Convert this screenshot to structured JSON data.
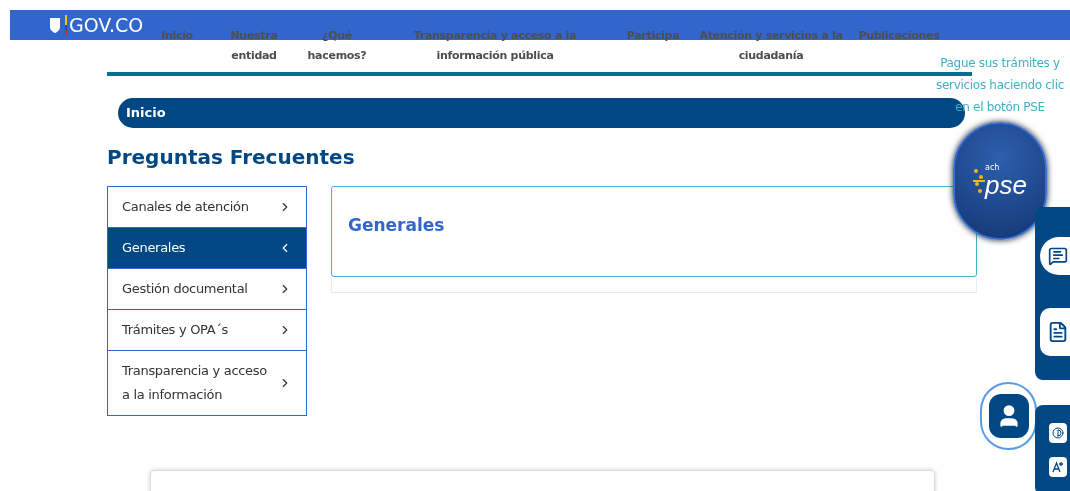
{
  "gov_bar": {
    "logo": "GOV.CO"
  },
  "nav": [
    {
      "label": "Inicio"
    },
    {
      "label": "Nuestra entidad"
    },
    {
      "label": "¿Qué hacemos?"
    },
    {
      "label": "Transparencia y acceso a la información pública"
    },
    {
      "label": "Participa"
    },
    {
      "label": "Atención y servicios a la ciudadanía"
    },
    {
      "label": "Publicaciones"
    }
  ],
  "breadcrumb": "Inicio",
  "page_title": "Preguntas Frecuentes",
  "sidebar": {
    "items": [
      {
        "label": "Canales de atención",
        "selected": false
      },
      {
        "label": "Generales",
        "selected": true
      },
      {
        "label": "Gestión documental",
        "selected": false
      },
      {
        "label": "Trámites y OPA´s",
        "selected": false
      },
      {
        "label": "Transparencia y acceso a la información",
        "selected": false
      }
    ]
  },
  "content": {
    "heading": "Generales"
  },
  "pse": {
    "message": "Pague sus trámites y servicios haciendo clic en el botón PSE",
    "logo_small": "ach",
    "logo": "pse"
  }
}
